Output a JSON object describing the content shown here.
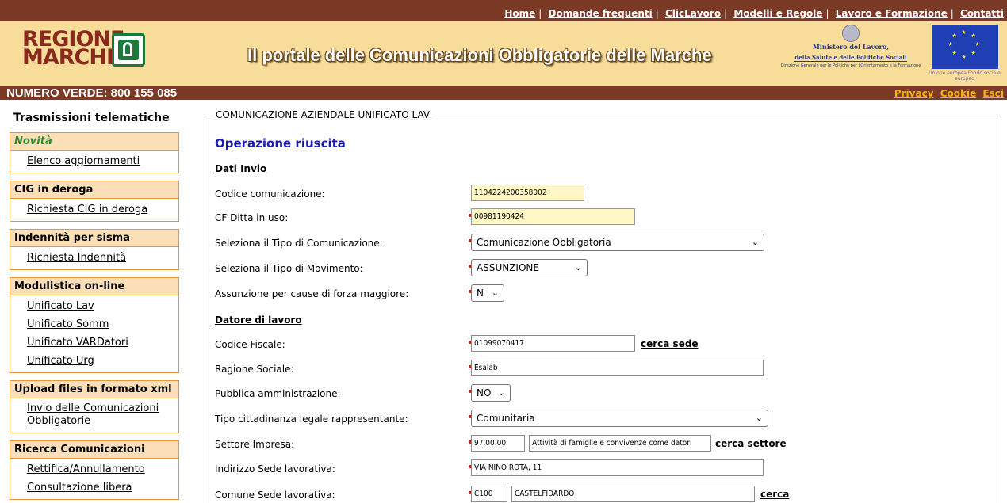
{
  "topnav": {
    "links": [
      "Home",
      "Domande frequenti",
      "ClicLavoro",
      "Modelli e Regole",
      "Lavoro e Formazione",
      "Contatti"
    ]
  },
  "banner": {
    "logo_line1": "REGIONE",
    "logo_line2": "MARCHE",
    "title": "Il portale delle Comunicazioni Obbligatorie delle Marche",
    "ministero_line1": "Ministero del Lavoro,",
    "ministero_line2": "della Salute e delle Politiche Sociali",
    "ministero_line3": "Direzione Generale per le Politiche per l'Orientamento e la Formazione",
    "eu_caption": "Unione europea Fondo sociale europeo"
  },
  "bar": {
    "numero_verde": "NUMERO VERDE: 800 155 085",
    "privacy": "Privacy",
    "cookie": "Cookie",
    "esci": "Esci"
  },
  "sidebar": {
    "title": "Trasmissioni telematiche",
    "sections": [
      {
        "head": "Novità",
        "items": [
          "Elenco aggiornamenti"
        ]
      },
      {
        "head": "CIG in deroga",
        "items": [
          "Richiesta CIG in deroga"
        ]
      },
      {
        "head": "Indennità per sisma",
        "items": [
          "Richiesta Indennità"
        ]
      },
      {
        "head": "Modulistica on-line",
        "items": [
          "Unificato Lav",
          "Unificato Somm",
          "Unificato VARDatori",
          "Unificato Urg"
        ]
      },
      {
        "head": "Upload files in formato xml",
        "items": [
          "Invio delle Comunicazioni Obbligatorie"
        ]
      },
      {
        "head": "Ricerca Comunicazioni",
        "items": [
          "Rettifica/Annullamento",
          "Consultazione libera"
        ]
      }
    ]
  },
  "main": {
    "legend": "COMUNICAZIONE AZIENDALE UNIFICATO LAV",
    "status": "Operazione riuscita",
    "section_invio": "Dati Invio",
    "section_datore": "Datore di lavoro",
    "fields": {
      "codice_comunicazione": {
        "label": "Codice comunicazione:",
        "value": "1104224200358002"
      },
      "cf_ditta": {
        "label": "CF Ditta in uso:",
        "value": "00981190424"
      },
      "tipo_comunicazione": {
        "label": "Seleziona il Tipo di Comunicazione:",
        "value": "Comunicazione Obbligatoria"
      },
      "tipo_movimento": {
        "label": "Seleziona il Tipo di Movimento:",
        "value": "ASSUNZIONE"
      },
      "forza_maggiore": {
        "label": "Assunzione per cause di forza maggiore:",
        "value": "N"
      },
      "codice_fiscale": {
        "label": "Codice Fiscale:",
        "value": "01099070417",
        "link": "cerca sede"
      },
      "ragione_sociale": {
        "label": "Ragione Sociale:",
        "value": "Esalab"
      },
      "pubblica_amministrazione": {
        "label": "Pubblica amministrazione:",
        "value": "NO"
      },
      "cittadinanza": {
        "label": "Tipo cittadinanza legale rappresentante:",
        "value": "Comunitaria"
      },
      "settore": {
        "label": "Settore Impresa:",
        "code": "97.00.00",
        "value": "Attività di famiglie e convivenze come datori",
        "link": "cerca settore"
      },
      "indirizzo": {
        "label": "Indirizzo Sede lavorativa:",
        "value": "VIA NINO ROTA, 11"
      },
      "comune": {
        "label": "Comune Sede lavorativa:",
        "code": "C100",
        "value": "CASTELFIDARDO",
        "link": "cerca"
      }
    }
  }
}
